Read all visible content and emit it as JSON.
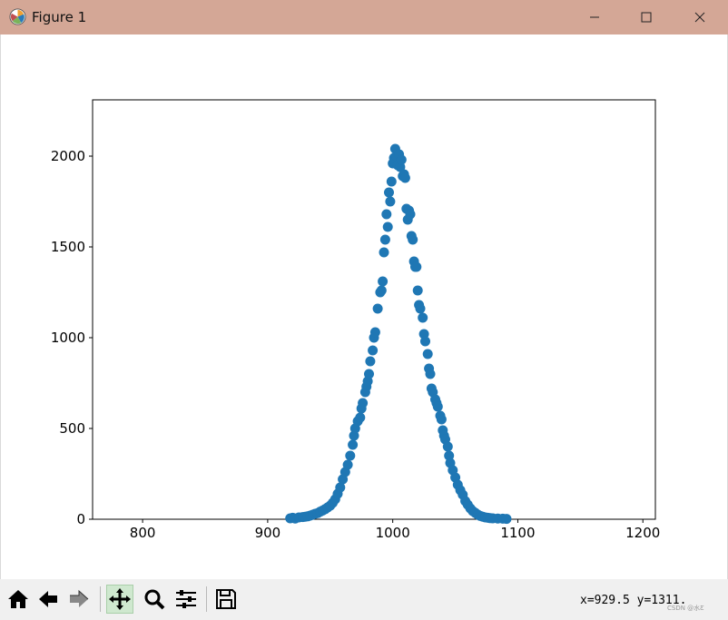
{
  "window": {
    "title": "Figure 1"
  },
  "toolbar": {
    "tools": [
      "home-icon",
      "back-icon",
      "forward-icon",
      "pan-icon",
      "zoom-icon",
      "subplots-icon",
      "save-icon"
    ],
    "active_tool": "pan-icon",
    "coords": "x=929.5 y=1311.",
    "watermark": "CSDN @水Ƹ"
  },
  "colors": {
    "titlebar": "#d4a796",
    "marker": "#1f77b4"
  },
  "chart_data": {
    "type": "scatter",
    "title": "",
    "xlabel": "",
    "ylabel": "",
    "xlim": [
      760,
      1210
    ],
    "ylim": [
      0,
      2310
    ],
    "xticks": [
      800,
      900,
      1000,
      1100,
      1200
    ],
    "yticks": [
      0,
      500,
      1000,
      1500,
      2000
    ],
    "grid": false,
    "series": [
      {
        "marker": "circle",
        "color": "#1f77b4",
        "x": [
          918,
          920,
          922,
          925,
          928,
          930,
          932,
          934,
          936,
          938,
          940,
          942,
          944,
          946,
          948,
          950,
          952,
          954,
          956,
          958,
          960,
          962,
          964,
          966,
          968,
          969,
          970,
          972,
          974,
          975,
          976,
          978,
          979,
          980,
          981,
          982,
          984,
          985,
          986,
          988,
          990,
          991,
          992,
          993,
          994,
          995,
          996,
          997,
          998,
          999,
          1000,
          1001,
          1002,
          1003,
          1004,
          1005,
          1006,
          1007,
          1008,
          1009,
          1010,
          1011,
          1012,
          1013,
          1014,
          1015,
          1016,
          1017,
          1018,
          1019,
          1020,
          1021,
          1022,
          1024,
          1025,
          1026,
          1028,
          1029,
          1030,
          1031,
          1032,
          1034,
          1035,
          1036,
          1038,
          1039,
          1040,
          1041,
          1042,
          1044,
          1045,
          1046,
          1048,
          1050,
          1052,
          1054,
          1056,
          1058,
          1060,
          1062,
          1064,
          1066,
          1068,
          1070,
          1072,
          1074,
          1076,
          1078,
          1080,
          1084,
          1088,
          1091
        ],
        "y": [
          5,
          8,
          4,
          10,
          12,
          14,
          16,
          20,
          25,
          30,
          34,
          42,
          48,
          56,
          65,
          75,
          90,
          110,
          140,
          175,
          220,
          260,
          300,
          350,
          410,
          460,
          500,
          540,
          560,
          610,
          640,
          700,
          730,
          760,
          800,
          870,
          930,
          1000,
          1030,
          1160,
          1250,
          1260,
          1310,
          1470,
          1540,
          1680,
          1610,
          1800,
          1750,
          1860,
          1960,
          1990,
          2040,
          2000,
          1950,
          2010,
          1940,
          1980,
          1890,
          1900,
          1880,
          1710,
          1650,
          1700,
          1680,
          1560,
          1540,
          1420,
          1390,
          1390,
          1260,
          1180,
          1160,
          1110,
          1020,
          980,
          910,
          830,
          800,
          720,
          700,
          660,
          640,
          620,
          570,
          550,
          490,
          460,
          440,
          400,
          350,
          310,
          270,
          230,
          190,
          160,
          135,
          100,
          80,
          60,
          45,
          35,
          25,
          18,
          14,
          10,
          8,
          6,
          5,
          4,
          3,
          2
        ]
      }
    ]
  }
}
